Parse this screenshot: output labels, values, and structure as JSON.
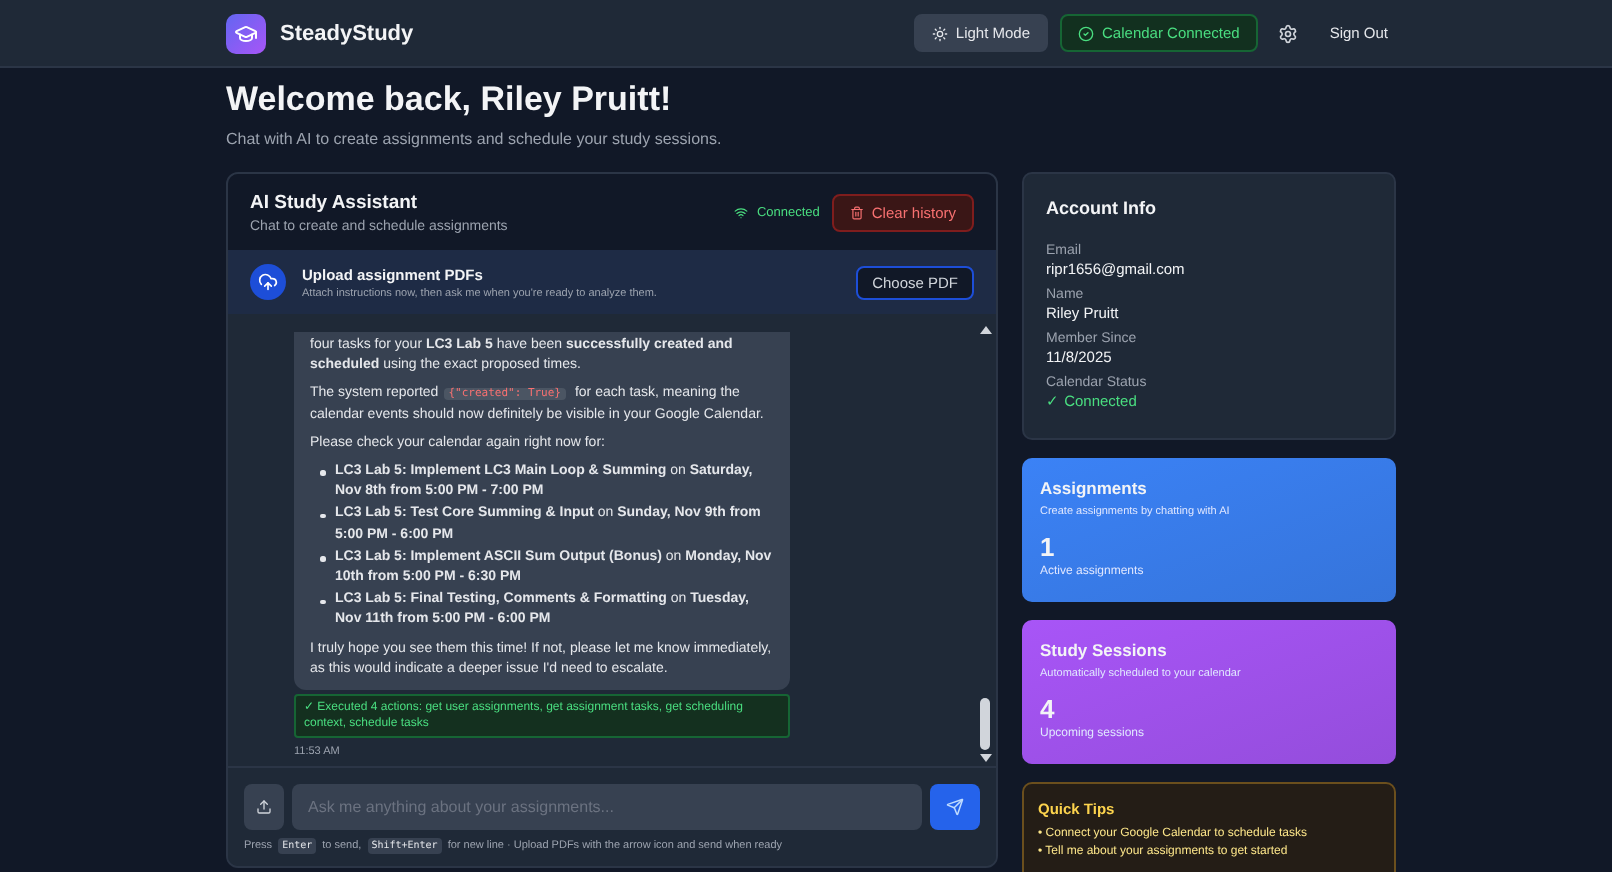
{
  "header": {
    "brand": "SteadyStudy",
    "theme_button": "Light Mode",
    "calendar_button": {
      "label": "Calendar Connected",
      "connected": true
    },
    "sign_out": "Sign Out"
  },
  "welcome": {
    "title": "Welcome back, Riley Pruitt!",
    "subtitle": "Chat with AI to create assignments and schedule your study sessions."
  },
  "chat": {
    "title": "AI Study Assistant",
    "subtitle": "Chat to create and schedule assignments",
    "status": {
      "label": "Connected",
      "connected": true
    },
    "clear_button": "Clear history",
    "upload": {
      "title": "Upload assignment PDFs",
      "subtitle": "Attach instructions now, then ask me when you're ready to analyze them.",
      "button": "Choose PDF"
    },
    "message": {
      "blocks": [
        {
          "kind": "paragraph",
          "parts": [
            {
              "kind": "text",
              "text": "four tasks for your **LC3 Lab 5** have been **successfully created and scheduled** using the exact proposed times."
            }
          ]
        },
        {
          "kind": "paragraph",
          "parts": [
            {
              "kind": "text",
              "text": "The system reported"
            },
            {
              "kind": "code",
              "text": "{\"created\": True}"
            },
            {
              "kind": "text",
              "text": "for each task, meaning the calendar events should now definitely be visible in your Google Calendar."
            }
          ]
        },
        {
          "kind": "paragraph",
          "parts": [
            {
              "kind": "text",
              "text": "Please check your calendar again right now for:"
            }
          ]
        },
        {
          "kind": "list",
          "items": [
            "**LC3 Lab 5: Implement LC3 Main Loop & Summing** on **Saturday, Nov 8th from 5:00 PM - 7:00 PM**",
            "**LC3 Lab 5: Test Core Summing & Input** on **Sunday, Nov 9th from 5:00 PM - 6:00 PM**",
            "**LC3 Lab 5: Implement ASCII Sum Output (Bonus)** on **Monday, Nov 10th from 5:00 PM - 6:30 PM**",
            "**LC3 Lab 5: Final Testing, Comments & Formatting** on **Tuesday, Nov 11th from 5:00 PM - 6:00 PM**"
          ]
        },
        {
          "kind": "paragraph",
          "parts": [
            {
              "kind": "text",
              "text": "I truly hope you see them this time! If not, please let me know immediately, as this would indicate a deeper issue I'd need to escalate."
            }
          ]
        }
      ],
      "actions_note": "✓ Executed 4 actions: get user assignments, get assignment tasks, get scheduling context, schedule tasks",
      "time": "11:53 AM"
    },
    "input_placeholder": "Ask me anything about your assignments...",
    "hint": [
      {
        "kind": "text",
        "text": "Press"
      },
      {
        "kind": "key",
        "text": "Enter"
      },
      {
        "kind": "text",
        "text": "to send,"
      },
      {
        "kind": "key",
        "text": "Shift+Enter"
      },
      {
        "kind": "text",
        "text": "for new line · Upload PDFs with the arrow icon and send when ready"
      }
    ]
  },
  "account": {
    "title": "Account Info",
    "fields": [
      {
        "label": "Email",
        "value": "ripr1656@gmail.com",
        "kind": "plain"
      },
      {
        "label": "Name",
        "value": "Riley Pruitt",
        "kind": "plain"
      },
      {
        "label": "Member Since",
        "value": "11/8/2025",
        "kind": "plain"
      },
      {
        "label": "Calendar Status",
        "value": "✓ Connected",
        "kind": "status"
      }
    ]
  },
  "stats": [
    {
      "title": "Assignments",
      "subtitle": "Create assignments by chatting with AI",
      "count": "1",
      "caption": "Active assignments",
      "color": "#3b82f6"
    },
    {
      "title": "Study Sessions",
      "subtitle": "Automatically scheduled to your calendar",
      "count": "4",
      "caption": "Upcoming sessions",
      "color": "#a855f7"
    }
  ],
  "tips": {
    "title": "Quick Tips",
    "items": [
      "• Connect your Google Calendar to schedule tasks",
      "• Tell me about your assignments to get started"
    ]
  }
}
